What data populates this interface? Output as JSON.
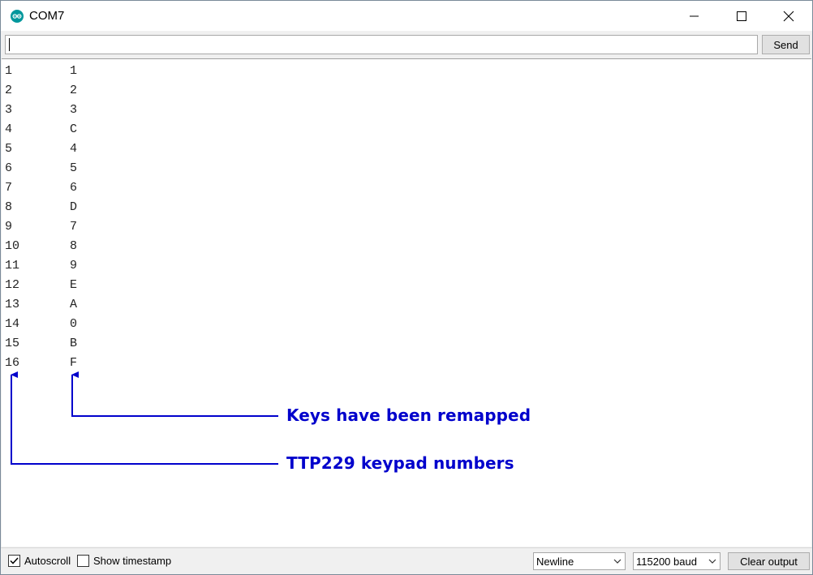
{
  "window": {
    "title": "COM7"
  },
  "input": {
    "value": "",
    "send_label": "Send"
  },
  "output": {
    "rows": [
      {
        "a": "1",
        "b": "1"
      },
      {
        "a": "2",
        "b": "2"
      },
      {
        "a": "3",
        "b": "3"
      },
      {
        "a": "4",
        "b": "C"
      },
      {
        "a": "5",
        "b": "4"
      },
      {
        "a": "6",
        "b": "5"
      },
      {
        "a": "7",
        "b": "6"
      },
      {
        "a": "8",
        "b": "D"
      },
      {
        "a": "9",
        "b": "7"
      },
      {
        "a": "10",
        "b": "8"
      },
      {
        "a": "11",
        "b": "9"
      },
      {
        "a": "12",
        "b": "E"
      },
      {
        "a": "13",
        "b": "A"
      },
      {
        "a": "14",
        "b": "0"
      },
      {
        "a": "15",
        "b": "B"
      },
      {
        "a": "16",
        "b": "F"
      }
    ]
  },
  "annotations": {
    "remapped": "Keys have been remapped",
    "keypad": "TTP229 keypad numbers",
    "color": "#0000cc"
  },
  "status": {
    "autoscroll_label": "Autoscroll",
    "autoscroll_checked": true,
    "timestamp_label": "Show timestamp",
    "timestamp_checked": false,
    "line_ending": "Newline",
    "baud": "115200 baud",
    "clear_label": "Clear output"
  },
  "icons": {
    "app": "arduino-icon",
    "minimize": "minimize-icon",
    "maximize": "maximize-icon",
    "close": "close-icon"
  }
}
